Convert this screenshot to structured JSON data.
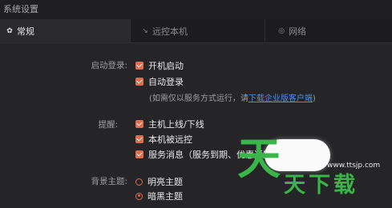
{
  "window": {
    "title": "系统设置"
  },
  "tabs": [
    {
      "label": "常规",
      "icon": "gear-icon",
      "active": true
    },
    {
      "label": "远控本机",
      "icon": "remote-icon",
      "active": false
    },
    {
      "label": "网络",
      "icon": "network-icon",
      "active": false
    }
  ],
  "startup": {
    "label": "启动登录:",
    "options": [
      "开机启动",
      "自动登录"
    ],
    "note_prefix": "(如需仅以服务方式运行，请",
    "note_link": "下载企业版客户端",
    "note_suffix": ")"
  },
  "reminder": {
    "label": "提醒:",
    "options": [
      "主机上线/下线",
      "本机被远控",
      "服务消息（服务到期、优惠通知）"
    ]
  },
  "theme": {
    "label": "背景主题:",
    "options": [
      {
        "label": "明亮主题",
        "checked": false
      },
      {
        "label": "暗黑主题",
        "checked": true
      }
    ]
  },
  "colors": {
    "accent": "#e06c4d",
    "link": "#4c8ee8",
    "watermark_green": "#39b54a"
  },
  "watermark": {
    "url": "www.ttsjp.com",
    "big_char": "天",
    "text": "天下载"
  }
}
